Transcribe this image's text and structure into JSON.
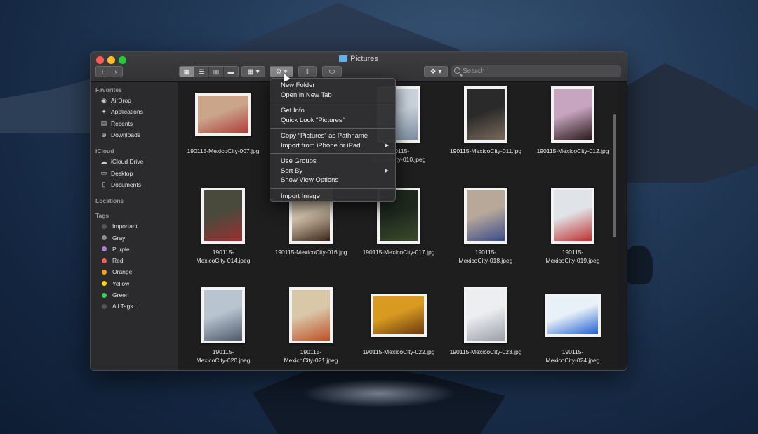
{
  "window": {
    "title": "Pictures"
  },
  "toolbar": {
    "back_icon": "chevron-left-icon",
    "forward_icon": "chevron-right-icon",
    "views": [
      "icon-view",
      "list-view",
      "column-view",
      "gallery-view"
    ],
    "search_placeholder": "Search"
  },
  "sidebar": {
    "favorites_heading": "Favorites",
    "favorites": [
      {
        "label": "AirDrop",
        "icon": "airdrop-icon"
      },
      {
        "label": "Applications",
        "icon": "applications-icon"
      },
      {
        "label": "Recents",
        "icon": "recents-icon"
      },
      {
        "label": "Downloads",
        "icon": "downloads-icon"
      }
    ],
    "icloud_heading": "iCloud",
    "icloud": [
      {
        "label": "iCloud Drive",
        "icon": "cloud-icon"
      },
      {
        "label": "Desktop",
        "icon": "desktop-icon"
      },
      {
        "label": "Documents",
        "icon": "document-icon"
      }
    ],
    "locations_heading": "Locations",
    "tags_heading": "Tags",
    "tags": [
      {
        "label": "Important",
        "color": "#555558"
      },
      {
        "label": "Gray",
        "color": "#8e8e93"
      },
      {
        "label": "Purple",
        "color": "#b07fe0"
      },
      {
        "label": "Red",
        "color": "#ff5b52"
      },
      {
        "label": "Orange",
        "color": "#ff9f0a"
      },
      {
        "label": "Yellow",
        "color": "#ffd60a"
      },
      {
        "label": "Green",
        "color": "#32d74b"
      },
      {
        "label": "All Tags...",
        "color": "#555558"
      }
    ]
  },
  "files": [
    {
      "name": "190115-MexicoCity-007.jpg",
      "tone": [
        "#caa58a",
        "#b03a3a"
      ]
    },
    {
      "name": "190115-MexicoCity-010.jpeg",
      "tone": [
        "#c9d2dc",
        "#7a8da0"
      ]
    },
    {
      "name": "190115-MexicoCity-011.jpg",
      "tone": [
        "#2a2a2a",
        "#7a6a5a"
      ]
    },
    {
      "name": "190115-MexicoCity-012.jpg",
      "tone": [
        "#c7a4bf",
        "#2a1a1a"
      ]
    },
    {
      "name": "190115-MexicoCity-014.jpeg",
      "tone": [
        "#4a4a3c",
        "#9a3030"
      ]
    },
    {
      "name": "190115-MexicoCity-016.jpg",
      "tone": [
        "#d8c8b0",
        "#3a2418"
      ]
    },
    {
      "name": "190115-MexicoCity-017.jpg",
      "tone": [
        "#1e2a1e",
        "#3a4a2a"
      ]
    },
    {
      "name": "190115-MexicoCity-018.jpeg",
      "tone": [
        "#b8a89a",
        "#3a4c8a"
      ]
    },
    {
      "name": "190115-MexicoCity-019.jpeg",
      "tone": [
        "#e0e4e8",
        "#c03030"
      ]
    },
    {
      "name": "190115-MexicoCity-020.jpeg",
      "tone": [
        "#b8c4d0",
        "#505a6a"
      ]
    },
    {
      "name": "190115-MexicoCity-021.jpeg",
      "tone": [
        "#d8c8a8",
        "#c0502a"
      ]
    },
    {
      "name": "190115-MexicoCity-022.jpg",
      "tone": [
        "#d89a20",
        "#6a3a10"
      ]
    },
    {
      "name": "190115-MexicoCity-023.jpg",
      "tone": [
        "#eceef0",
        "#9aa0a8"
      ]
    },
    {
      "name": "190115-MexicoCity-024.jpeg",
      "tone": [
        "#e8f0f8",
        "#2060d0"
      ]
    }
  ],
  "context_menu": {
    "groups": [
      [
        {
          "label": "New Folder"
        },
        {
          "label": "Open in New Tab"
        }
      ],
      [
        {
          "label": "Get Info"
        },
        {
          "label": "Quick Look “Pictures”"
        }
      ],
      [
        {
          "label": "Copy “Pictures” as Pathname"
        },
        {
          "label": "Import from iPhone or iPad",
          "submenu": true
        }
      ],
      [
        {
          "label": "Use Groups"
        },
        {
          "label": "Sort By",
          "submenu": true
        },
        {
          "label": "Show View Options"
        }
      ],
      [
        {
          "label": "Import Image"
        }
      ]
    ]
  }
}
